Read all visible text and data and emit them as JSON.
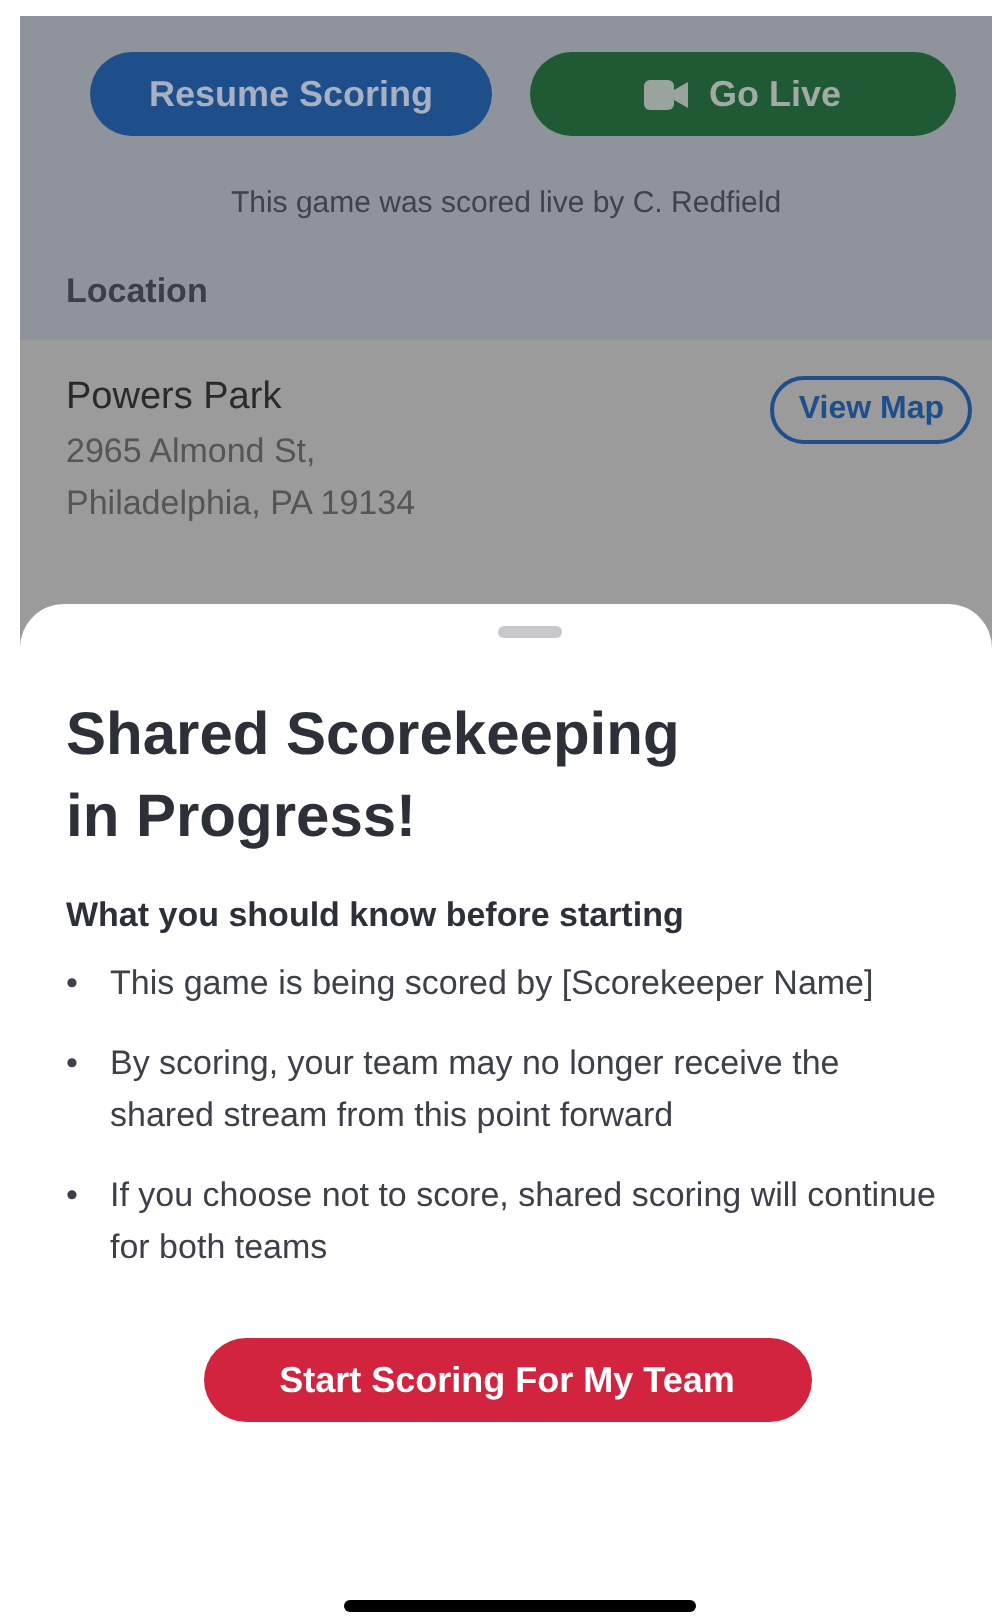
{
  "actions": [
    {
      "label": "Resume Scoring",
      "kind": "primary"
    },
    {
      "label": "Go Live",
      "kind": "live"
    }
  ],
  "scored_by": "This game was scored live by C. Redfield",
  "location": {
    "header": "Location",
    "name": "Powers Park",
    "address_lines": [
      "2965 Almond St,",
      "Philadelphia, PA 19134"
    ],
    "map_button": "View Map"
  },
  "sheet": {
    "title_lines": [
      "Shared Scorekeeping",
      "in Progress!"
    ],
    "subtitle": "What you should know before starting",
    "bullets": [
      {
        "marker": "•",
        "text": "This game is being scored by [Scorekeeper Name]"
      },
      {
        "marker": "•",
        "text": "By scoring, your team may no longer receive the shared stream from this point forward"
      },
      {
        "marker": "•",
        "text": "If you choose not to score, shared scoring will continue for both teams"
      }
    ],
    "button": "Start Scoring For My Team"
  }
}
